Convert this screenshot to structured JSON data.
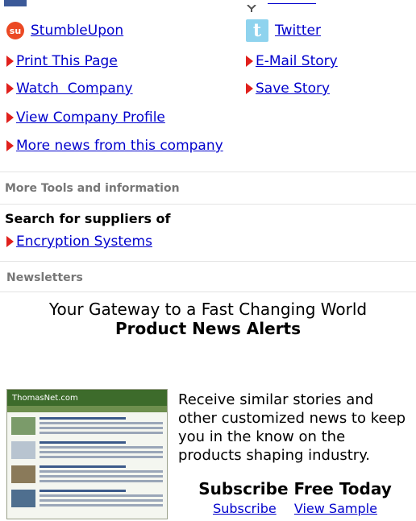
{
  "social": {
    "partial_icons": [
      "facebook-icon",
      "yahoo-icon"
    ],
    "stumbleupon": "StumbleUpon",
    "twitter": "Twitter"
  },
  "actions": {
    "print": "Print This Page",
    "email": "E-Mail Story",
    "watch": "Watch  Company",
    "save": "Save Story",
    "profile": "View Company Profile",
    "more_news": "More news from this company"
  },
  "tools": {
    "heading": "More Tools and information",
    "search_label": "Search for suppliers of",
    "supplier_link": "Encryption Systems"
  },
  "newsletters": {
    "heading": "Newsletters",
    "tagline": "Your Gateway to a Fast Changing World",
    "title": "Product News Alerts",
    "description": "Receive similar stories and other customized news to keep you in the know on the products shaping industry.",
    "subscribe_heading": "Subscribe Free Today",
    "subscribe_link": "Subscribe",
    "sample_link": "View Sample",
    "thumb_brand": "ThomasNet.com"
  },
  "colors": {
    "link": "#0000cc",
    "arrow": "#e0201c",
    "section_heading": "#777777"
  }
}
